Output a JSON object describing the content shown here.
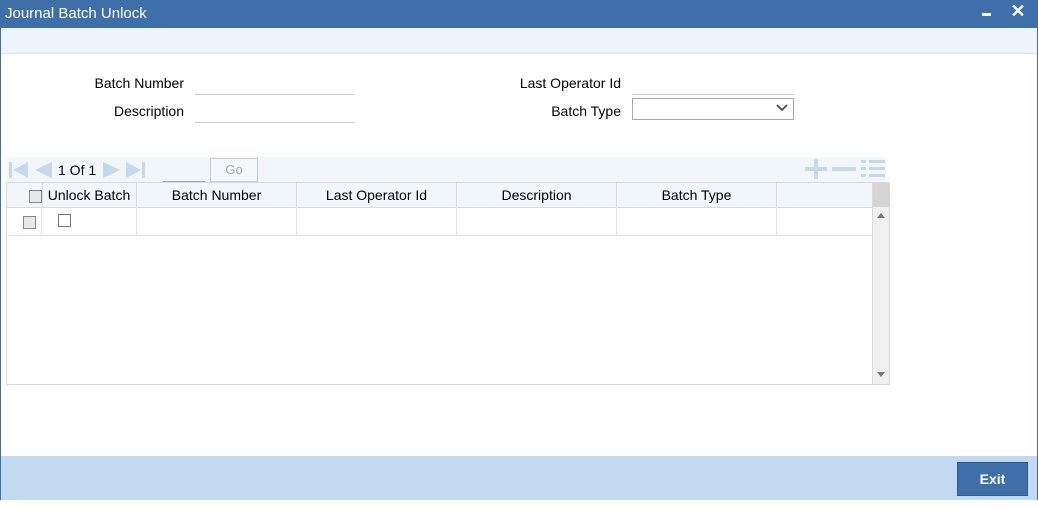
{
  "window": {
    "title": "Journal Batch Unlock",
    "close_glyph": "✕"
  },
  "form": {
    "batch_number_label": "Batch Number",
    "description_label": "Description",
    "last_operator_label": "Last Operator Id",
    "batch_type_label": "Batch Type",
    "batch_number_value": "",
    "description_value": "",
    "last_operator_value": "",
    "batch_type_selected": ""
  },
  "grid_toolbar": {
    "pager_text": "1 Of 1",
    "go_label": "Go",
    "icons": [
      "first-page-icon",
      "prev-page-icon",
      "next-page-icon",
      "last-page-icon",
      "add-row-icon",
      "delete-row-icon",
      "single-view-icon"
    ]
  },
  "table": {
    "columns": [
      "Unlock Batch",
      "Batch Number",
      "Last Operator Id",
      "Description",
      "Batch Type"
    ],
    "rows": [
      {
        "unlock_batch": "",
        "batch_number": "",
        "last_operator_id": "",
        "description": "",
        "batch_type": ""
      }
    ]
  },
  "footer": {
    "exit_label": "Exit"
  },
  "colors": {
    "titlebar": "#3e6fa9",
    "footer": "#c1daf0",
    "exit_button": "#3e6fa9",
    "disabled_icon": "#c6d8ec"
  }
}
